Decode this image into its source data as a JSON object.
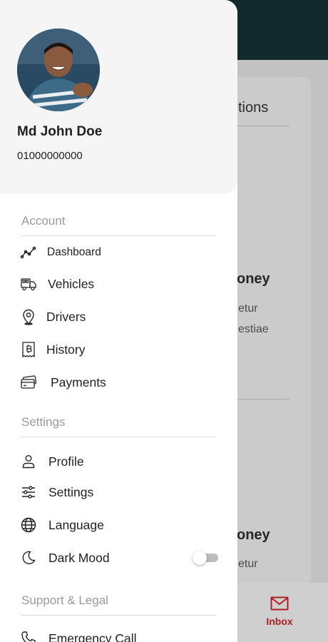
{
  "background": {
    "section_title": "tions",
    "card1": {
      "title": "oney",
      "line1": "etur",
      "line2": "estiae"
    },
    "card2": {
      "title": "oney",
      "line1": "etur"
    },
    "inbox_label": "Inbox",
    "accent_color": "#b01f24",
    "topbar_color": "#122a2b"
  },
  "profile": {
    "name": "Md John Doe",
    "phone": "01000000000",
    "avatar_icon": "avatar-photo"
  },
  "sections": {
    "account": "Account",
    "settings": "Settings",
    "support": "Support & Legal"
  },
  "menu": {
    "dashboard": "Dashboard",
    "vehicles": "Vehicles",
    "drivers": "Drivers",
    "history": "History",
    "payments": "Payments",
    "profile": "Profile",
    "settings": "Settings",
    "language": "Language",
    "dark_mode": "Dark Mood",
    "emergency": "Emergency Call"
  },
  "dark_mode_enabled": false
}
